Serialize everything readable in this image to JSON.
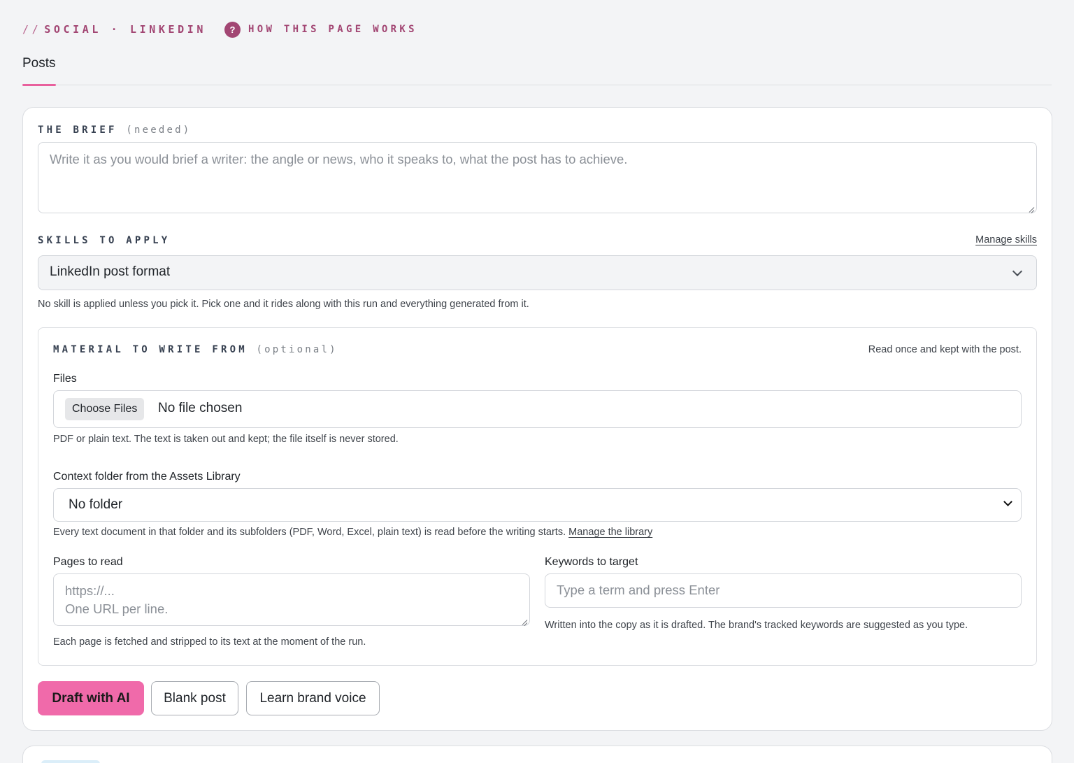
{
  "breadcrumb": {
    "slashes": "//",
    "text": "SOCIAL · LINKEDIN"
  },
  "help": {
    "icon": "?",
    "label": "HOW THIS PAGE WORKS"
  },
  "tabs": [
    {
      "label": "Posts",
      "active": true
    }
  ],
  "colors": {
    "accent": "#a24673",
    "primary_button": "#f06aaa",
    "tab_underline": "#e8609d"
  },
  "brief": {
    "label": "THE BRIEF",
    "hint": "(needed)",
    "placeholder": "Write it as you would brief a writer: the angle or news, who it speaks to, what the post has to achieve."
  },
  "skills": {
    "label": "SKILLS TO APPLY",
    "manage_link": "Manage skills",
    "selected": "LinkedIn post format",
    "help": "No skill is applied unless you pick it. Pick one and it rides along with this run and everything generated from it."
  },
  "material": {
    "label": "MATERIAL TO WRITE FROM",
    "hint": "(optional)",
    "note": "Read once and kept with the post.",
    "files": {
      "label": "Files",
      "button": "Choose Files",
      "status": "No file chosen",
      "help": "PDF or plain text. The text is taken out and kept; the file itself is never stored."
    },
    "folder": {
      "label": "Context folder from the Assets Library",
      "selected": "No folder",
      "help": "Every text document in that folder and its subfolders (PDF, Word, Excel, plain text) is read before the writing starts.",
      "link": "Manage the library"
    },
    "pages": {
      "label": "Pages to read",
      "placeholder_line1": "https://...",
      "placeholder_line2": "One URL per line.",
      "help": "Each page is fetched and stripped to its text at the moment of the run."
    },
    "keywords": {
      "label": "Keywords to target",
      "placeholder": "Type a term and press Enter",
      "help": "Written into the copy as it is drafted. The brand's tracked keywords are suggested as you type."
    }
  },
  "actions": {
    "draft": "Draft with AI",
    "blank": "Blank post",
    "learn": "Learn brand voice"
  }
}
